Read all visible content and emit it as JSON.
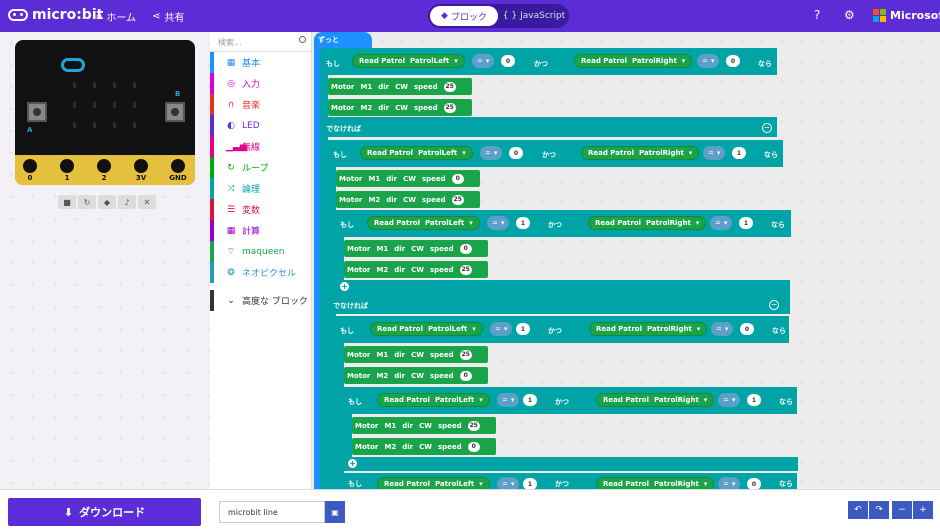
{
  "header": {
    "logo_text": "micro:bit",
    "home_label": "ホーム",
    "share_label": "共有",
    "blocks_tab": "ブロック",
    "js_tab": "JavaScript",
    "ms_label": "Microsoft"
  },
  "simulator": {
    "pins": [
      "0",
      "1",
      "2",
      "3V",
      "GND"
    ],
    "button_a": "A",
    "button_b": "B"
  },
  "toolbox": {
    "search_placeholder": "検索...",
    "categories": [
      {
        "label": "基本",
        "color": "#1e90ff",
        "icon": "grid-icon"
      },
      {
        "label": "入力",
        "color": "#d400d4",
        "icon": "target-icon"
      },
      {
        "label": "音楽",
        "color": "#e63022",
        "icon": "headphones-icon"
      },
      {
        "label": "LED",
        "color": "#5c2dd6",
        "icon": "toggle-icon"
      },
      {
        "label": "無線",
        "color": "#e3008c",
        "icon": "signal-icon"
      },
      {
        "label": "ループ",
        "color": "#00aa00",
        "icon": "loop-icon"
      },
      {
        "label": "論理",
        "color": "#00a4a6",
        "icon": "shuffle-icon"
      },
      {
        "label": "変数",
        "color": "#dc143c",
        "icon": "list-icon"
      },
      {
        "label": "計算",
        "color": "#9400d3",
        "icon": "calculator-icon"
      },
      {
        "label": "maqueen",
        "color": "#1aa44a",
        "icon": "wifi-icon"
      },
      {
        "label": "ネオピクセル",
        "color": "#2699bf",
        "icon": "spinner-icon"
      },
      {
        "label": "高度な ブロック",
        "color": "#333333",
        "icon": "chevron-down-icon"
      }
    ]
  },
  "workspace": {
    "forever_label": "ずっと",
    "if_label": "もし",
    "else_label": "でなければ",
    "and_label": "かつ",
    "then_label": "なら",
    "read_patrol": "Read Patrol",
    "patrol_left": "PatrolLeft",
    "patrol_right": "PatrolRight",
    "op_eq": "=",
    "motor_label": "Motor",
    "m1": "M1",
    "m2": "M2",
    "dir_label": "dir",
    "cw": "CW",
    "speed_label": "speed",
    "val_0": "0",
    "val_1": "1",
    "val_25": "25"
  },
  "footer": {
    "download_label": "ダウンロード",
    "project_name": "microbit line"
  }
}
